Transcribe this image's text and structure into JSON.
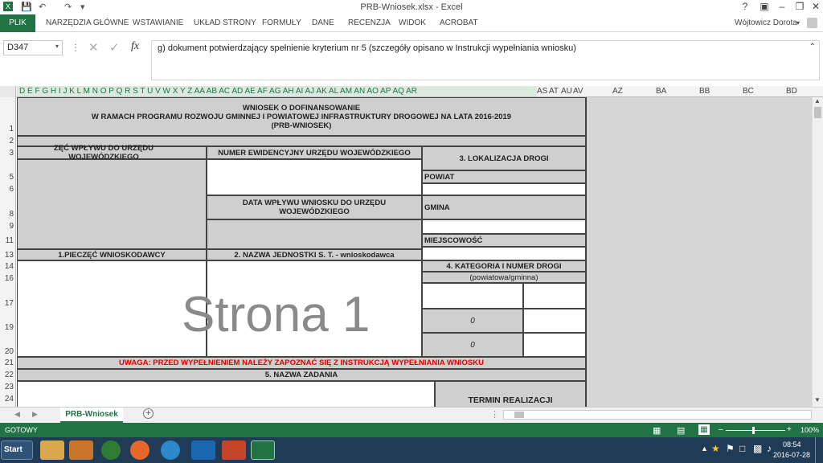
{
  "window": {
    "title": "PRB-Wniosek.xlsx - Excel",
    "help": "?",
    "user": "Wójtowicz Dorota"
  },
  "ribbon": {
    "tabs": [
      "PLIK",
      "NARZĘDZIA GŁÓWNE",
      "WSTAWIANIE",
      "UKŁAD STRONY",
      "FORMUŁY",
      "DANE",
      "RECENZJA",
      "WIDOK",
      "ACROBAT"
    ]
  },
  "formula_bar": {
    "name_box": "D347",
    "fx": "fx",
    "content": "g) dokument potwierdzający spełnienie kryterium nr 5 (szczegóły opisano w Instrukcji wypełniania wniosku)"
  },
  "columns": {
    "narrow": "D E F G H I J K L M N O P Q R S T U V W X Y Z AA AB AC AD AE AF AG AH AI AJ AK AL AM AN AO AP AQ AR",
    "after": [
      "AS",
      "AT",
      "AU",
      "AV"
    ],
    "wide": [
      "AZ",
      "BA",
      "BB",
      "BC",
      "BD"
    ]
  },
  "rows": [
    "1",
    "2",
    "3",
    "5",
    "6",
    "8",
    "9",
    "11",
    "13",
    "14",
    "16",
    "17",
    "19",
    "20",
    "21",
    "22",
    "23",
    "24"
  ],
  "form": {
    "title1": "WNIOSEK O DOFINANSOWANIE",
    "title2": "W RAMACH PROGRAMU ROZWOJU GMINNEJ I POWIATOWEJ INFRASTRUKTURY DROGOWEJ NA LATA 2016-2019",
    "title3": "(PRB-WNIOSEK)",
    "stamp_label": "ZĘĆ WPŁYWU DO URZĘDU WOJEWÓDZKIEGO",
    "reg_no_label": "NUMER EWIDENCYJNY URZĘDU WOJEWÓDZKIEGO",
    "location_label": "3. LOKALIZACJA DROGI",
    "powiat_label": "POWIAT",
    "date_label": "DATA WPŁYWU WNIOSKU DO URZĘDU WOJEWÓDZKIEGO",
    "gmina_label": "GMINA",
    "place_label": "MIEJSCOWOŚĆ",
    "applicant_stamp_label": "1.PIECZĘĆ WNIOSKODAWCY",
    "unit_name_label": "2. NAZWA JEDNOSTKI S. T. - wnioskodawca",
    "category_label": "4. KATEGORIA I NUMER DROGI",
    "category_sub": "(powiatowa/gminna)",
    "zero1": "0",
    "zero2": "0",
    "watermark": "Strona 1",
    "warning": "UWAGA: PRZED WYPEŁNIENIEM NALEŻY ZAPOZNAĆ SIĘ Z INSTRUKCJĄ WYPEŁNIANIA WNIOSKU",
    "task_name_label": "5. NAZWA ZADANIA",
    "deadline_label": "TERMIN REALIZACJI"
  },
  "sheet_tabs": {
    "active": "PRB-Wniosek",
    "add": "+"
  },
  "status": {
    "state": "GOTOWY",
    "zoom": "100%"
  },
  "taskbar": {
    "start": "Start",
    "time": "08:54",
    "date": "2016-07-28"
  },
  "colors": {
    "excel_green": "#217346",
    "warning_red": "#e00000",
    "taskbar": "#1f3b55"
  }
}
